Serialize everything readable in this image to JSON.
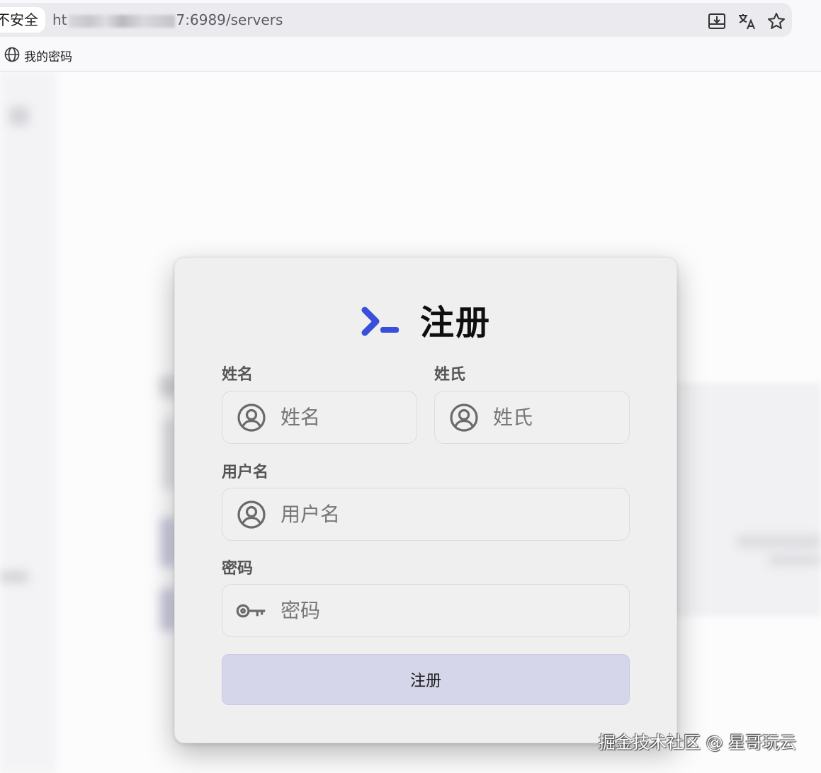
{
  "browser": {
    "security_label": "不安全",
    "url_prefix": "ht",
    "url_suffix": "7:6989/servers",
    "bookmark_label": "我的密码"
  },
  "form": {
    "title": "注册",
    "first_name": {
      "label": "姓名",
      "placeholder": "姓名"
    },
    "last_name": {
      "label": "姓氏",
      "placeholder": "姓氏"
    },
    "username": {
      "label": "用户名",
      "placeholder": "用户名"
    },
    "password": {
      "label": "密码",
      "placeholder": "密码"
    },
    "submit_label": "注册"
  },
  "watermark": "掘金技术社区 @ 星哥玩云",
  "colors": {
    "accent": "#3a4fd8",
    "button_bg": "#d5d6e9",
    "card_bg": "#efefef"
  },
  "icons": {
    "download": "download-icon",
    "translate": "translate-icon",
    "star": "star-icon",
    "globe": "globe-icon",
    "logo": "terminal-prompt-icon",
    "user": "user-circle-icon",
    "key": "key-icon"
  }
}
